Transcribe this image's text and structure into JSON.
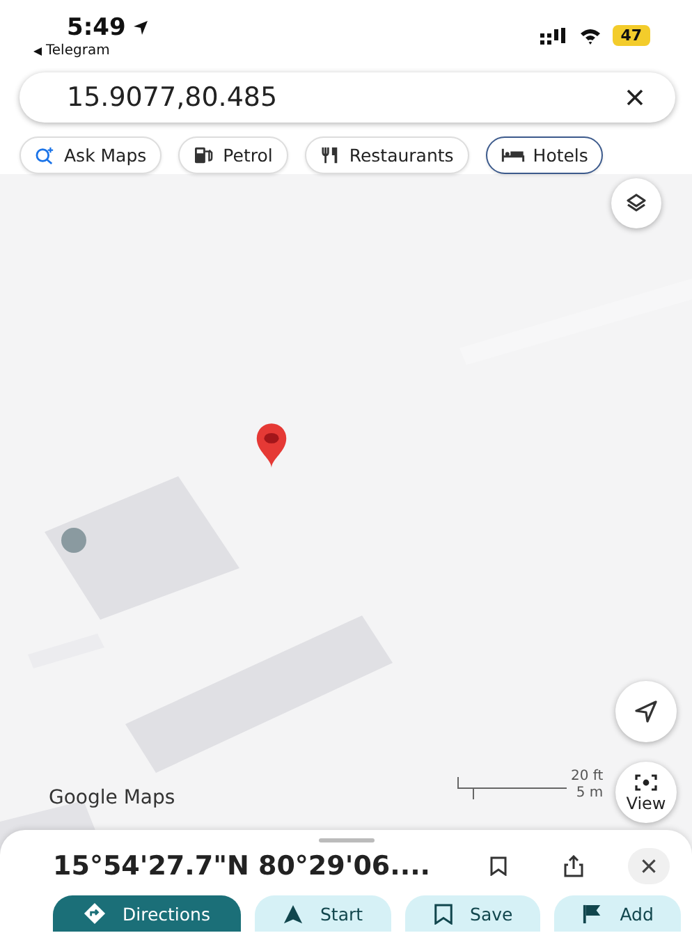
{
  "status_bar": {
    "time": "5:49",
    "back_app": "Telegram",
    "battery": "47",
    "battery_low_power": true
  },
  "search": {
    "value": "15.9077,80.485"
  },
  "chips": [
    {
      "label": "Ask Maps",
      "kind": "ask",
      "selected": false
    },
    {
      "label": "Petrol",
      "kind": "petrol",
      "selected": false
    },
    {
      "label": "Restaurants",
      "kind": "restaurants",
      "selected": false
    },
    {
      "label": "Hotels",
      "kind": "hotels",
      "selected": true
    }
  ],
  "map": {
    "attribution": "Google Maps",
    "scale": {
      "imperial": "20 ft",
      "metric": "5 m"
    },
    "view_button": "View"
  },
  "place_sheet": {
    "title": "15°54'27.7\"N 80°29'06....",
    "actions": [
      {
        "label": "Directions",
        "kind": "directions",
        "primary": true
      },
      {
        "label": "Start",
        "kind": "start",
        "primary": false
      },
      {
        "label": "Save",
        "kind": "save",
        "primary": false
      },
      {
        "label": "Add",
        "kind": "add",
        "primary": false
      }
    ]
  }
}
